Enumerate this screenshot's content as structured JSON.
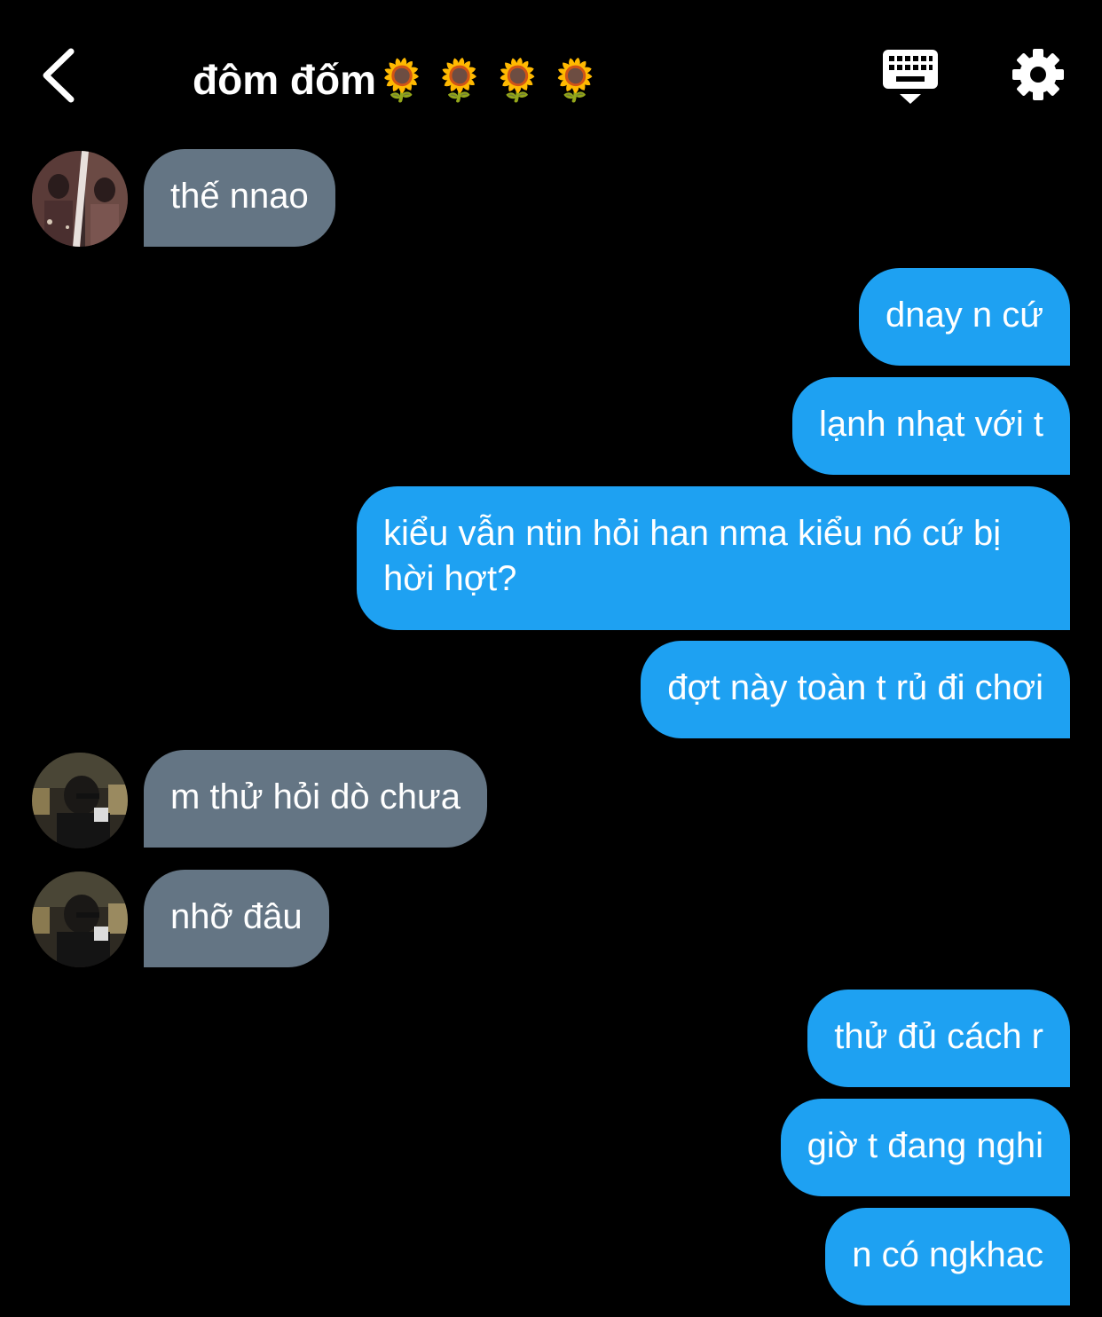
{
  "header": {
    "title": "đôm đốm",
    "title_emoji": "🌻🌻🌻🌻",
    "back_icon": "chevron-left-icon",
    "keyboard_icon": "keyboard-hide-icon",
    "settings_icon": "gear-icon"
  },
  "colors": {
    "background": "#000000",
    "incoming_bubble": "#647584",
    "outgoing_bubble": "#1ea1f2",
    "text": "#ffffff"
  },
  "messages": [
    {
      "direction": "incoming",
      "text": "thế nnao"
    },
    {
      "direction": "outgoing",
      "text": "dnay n cứ"
    },
    {
      "direction": "outgoing",
      "text": "lạnh nhạt với t"
    },
    {
      "direction": "outgoing",
      "text": "kiểu vẫn ntin hỏi han nma kiểu nó cứ bị hời hợt?"
    },
    {
      "direction": "outgoing",
      "text": "đợt này toàn t rủ đi chơi"
    },
    {
      "direction": "incoming",
      "text": "m thử hỏi dò chưa"
    },
    {
      "direction": "incoming",
      "text": "nhỡ đâu"
    },
    {
      "direction": "outgoing",
      "text": "thử đủ cách r"
    },
    {
      "direction": "outgoing",
      "text": "giờ t đang nghi"
    },
    {
      "direction": "outgoing",
      "text": "n có ngkhac"
    }
  ]
}
